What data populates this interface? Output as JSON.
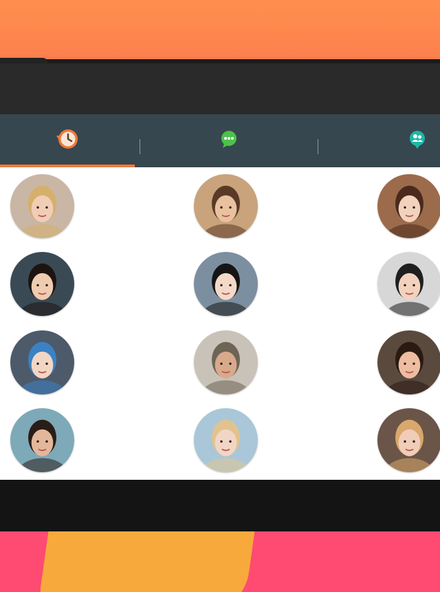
{
  "colors": {
    "promo_top": "#fd7f4f",
    "tabbar": "#37474f",
    "active_tab_accent": "#f07a3a",
    "grid_background": "#ffffff",
    "promo_bottom": "#ff4a72",
    "promo_blob": "#f8a93c"
  },
  "tabs": [
    {
      "icon": "clock-history-icon",
      "active": true
    },
    {
      "icon": "chat-bubble-icon",
      "active": false
    },
    {
      "icon": "group-contacts-icon",
      "active": false
    }
  ],
  "avatars": [
    {
      "icon": "user-avatar-photo",
      "bg": "#c9b6a5",
      "skin": "#f1cdb5",
      "hair": "#d4b06c"
    },
    {
      "icon": "user-avatar-photo",
      "bg": "#c9a37b",
      "skin": "#e9c19f",
      "hair": "#5a3a27"
    },
    {
      "icon": "user-avatar-photo",
      "bg": "#9b6b4b",
      "skin": "#f2d2bc",
      "hair": "#4a2a1d"
    },
    {
      "icon": "user-avatar-photo",
      "bg": "#3a4a55",
      "skin": "#efcbb0",
      "hair": "#1d1410"
    },
    {
      "icon": "user-avatar-photo",
      "bg": "#7c8fa0",
      "skin": "#f4d9c8",
      "hair": "#151515"
    },
    {
      "icon": "user-avatar-photo",
      "bg": "#d7d7d7",
      "skin": "#f3d2bd",
      "hair": "#1f1f1f"
    },
    {
      "icon": "user-avatar-photo",
      "bg": "#4c5a6a",
      "skin": "#f2d6c4",
      "hair": "#3b82c4"
    },
    {
      "icon": "user-avatar-photo",
      "bg": "#c9c2b8",
      "skin": "#d8a98a",
      "hair": "#6d6456"
    },
    {
      "icon": "user-avatar-photo",
      "bg": "#5a4a3e",
      "skin": "#eebca1",
      "hair": "#2b1a12"
    },
    {
      "icon": "user-avatar-photo",
      "bg": "#7ea9b8",
      "skin": "#e3b79a",
      "hair": "#2a1d17"
    },
    {
      "icon": "user-avatar-photo",
      "bg": "#a9c7d8",
      "skin": "#f1d6c5",
      "hair": "#e1c38f"
    },
    {
      "icon": "user-avatar-photo",
      "bg": "#6b5548",
      "skin": "#f0cdb9",
      "hair": "#d9a86c"
    }
  ]
}
